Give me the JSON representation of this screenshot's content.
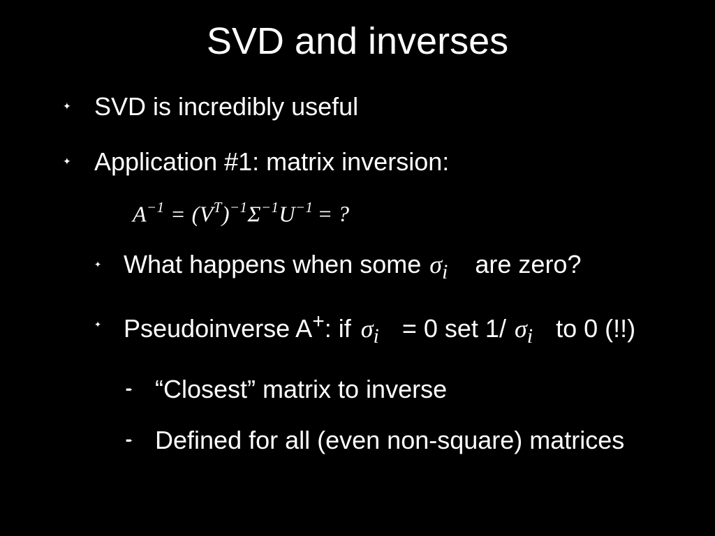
{
  "title": "SVD and inverses",
  "bullets": {
    "b1": "SVD is incredibly useful",
    "b2": "Application #1: matrix inversion:",
    "b3_a": "What happens when some",
    "b3_sigma": "σ",
    "b3_sub": "i",
    "b3_b": "are zero?",
    "b4_a": "Pseudoinverse A",
    "b4_sup": "+",
    "b4_b": ": if",
    "b4_sigma1": "σ",
    "b4_sub1": "i",
    "b4_c": "= 0 set 1/",
    "b4_sigma2": "σ",
    "b4_sub2": "i",
    "b4_d": "to 0 (!!)",
    "b5": "“Closest” matrix to inverse",
    "b6": "Defined for all (even non-square) matrices"
  },
  "formula": {
    "A": "A",
    "neg1": "−1",
    "eq": " = ",
    "open": "(",
    "V": "V",
    "T": "T",
    "close": ")",
    "Sigma": "Σ",
    "U": "U",
    "q": "= ?"
  }
}
